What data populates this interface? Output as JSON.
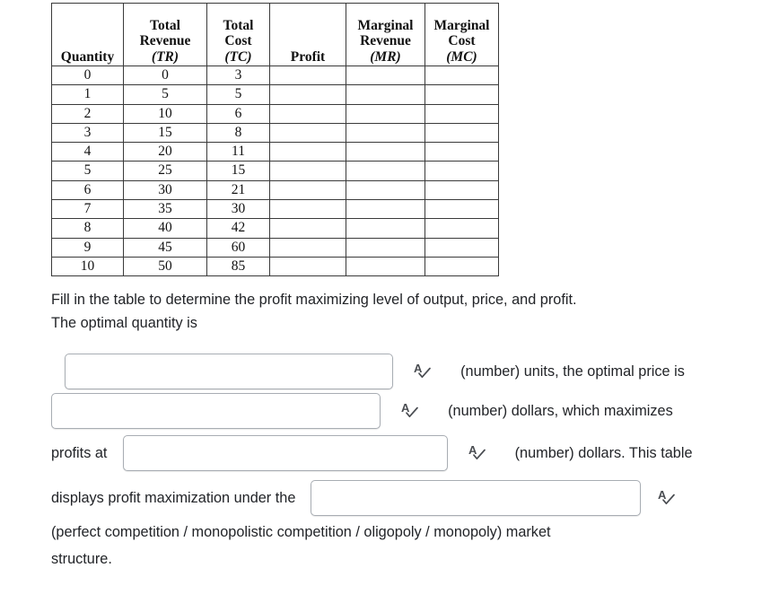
{
  "table": {
    "headers": [
      {
        "lines": [
          "Quantity"
        ],
        "abbr": ""
      },
      {
        "lines": [
          "Total",
          "Revenue"
        ],
        "abbr": "(TR)"
      },
      {
        "lines": [
          "Total",
          "Cost"
        ],
        "abbr": "(TC)"
      },
      {
        "lines": [
          "Profit"
        ],
        "abbr": ""
      },
      {
        "lines": [
          "Marginal",
          "Revenue"
        ],
        "abbr": "(MR)"
      },
      {
        "lines": [
          "Marginal",
          "Cost"
        ],
        "abbr": "(MC)"
      }
    ],
    "rows": [
      {
        "quantity": "0",
        "total_revenue": "0",
        "total_cost": "3",
        "profit": "",
        "marginal_revenue": "",
        "marginal_cost": ""
      },
      {
        "quantity": "1",
        "total_revenue": "5",
        "total_cost": "5",
        "profit": "",
        "marginal_revenue": "",
        "marginal_cost": ""
      },
      {
        "quantity": "2",
        "total_revenue": "10",
        "total_cost": "6",
        "profit": "",
        "marginal_revenue": "",
        "marginal_cost": ""
      },
      {
        "quantity": "3",
        "total_revenue": "15",
        "total_cost": "8",
        "profit": "",
        "marginal_revenue": "",
        "marginal_cost": ""
      },
      {
        "quantity": "4",
        "total_revenue": "20",
        "total_cost": "11",
        "profit": "",
        "marginal_revenue": "",
        "marginal_cost": ""
      },
      {
        "quantity": "5",
        "total_revenue": "25",
        "total_cost": "15",
        "profit": "",
        "marginal_revenue": "",
        "marginal_cost": ""
      },
      {
        "quantity": "6",
        "total_revenue": "30",
        "total_cost": "21",
        "profit": "",
        "marginal_revenue": "",
        "marginal_cost": ""
      },
      {
        "quantity": "7",
        "total_revenue": "35",
        "total_cost": "30",
        "profit": "",
        "marginal_revenue": "",
        "marginal_cost": ""
      },
      {
        "quantity": "8",
        "total_revenue": "40",
        "total_cost": "42",
        "profit": "",
        "marginal_revenue": "",
        "marginal_cost": ""
      },
      {
        "quantity": "9",
        "total_revenue": "45",
        "total_cost": "60",
        "profit": "",
        "marginal_revenue": "",
        "marginal_cost": ""
      },
      {
        "quantity": "10",
        "total_revenue": "50",
        "total_cost": "85",
        "profit": "",
        "marginal_revenue": "",
        "marginal_cost": ""
      }
    ]
  },
  "question": {
    "instruction_line1": "Fill in the table to determine the profit maximizing level of output, price, and profit.",
    "instruction_line2": "The optimal quantity is",
    "hint_quantity": "(number) units, the optimal price is",
    "hint_price": "(number) dollars, which maximizes",
    "label_profits_at": "profits at",
    "hint_profit": "(number) dollars. This table",
    "label_displays": "displays profit maximization under the",
    "closing_line1": "(perfect competition / monopolistic competition / oligopoly / monopoly) market",
    "closing_line2": "structure."
  },
  "answers": {
    "quantity_value": "",
    "quantity_placeholder": "",
    "price_value": "",
    "price_placeholder": "",
    "profit_value": "",
    "profit_placeholder": "",
    "structure_value": "",
    "structure_placeholder": ""
  },
  "colors": {
    "text": "#222428",
    "table_border": "#3a3a3a",
    "input_border": "#a8adb3",
    "icon": "#4a4d52",
    "page_background": "#ffffff"
  }
}
